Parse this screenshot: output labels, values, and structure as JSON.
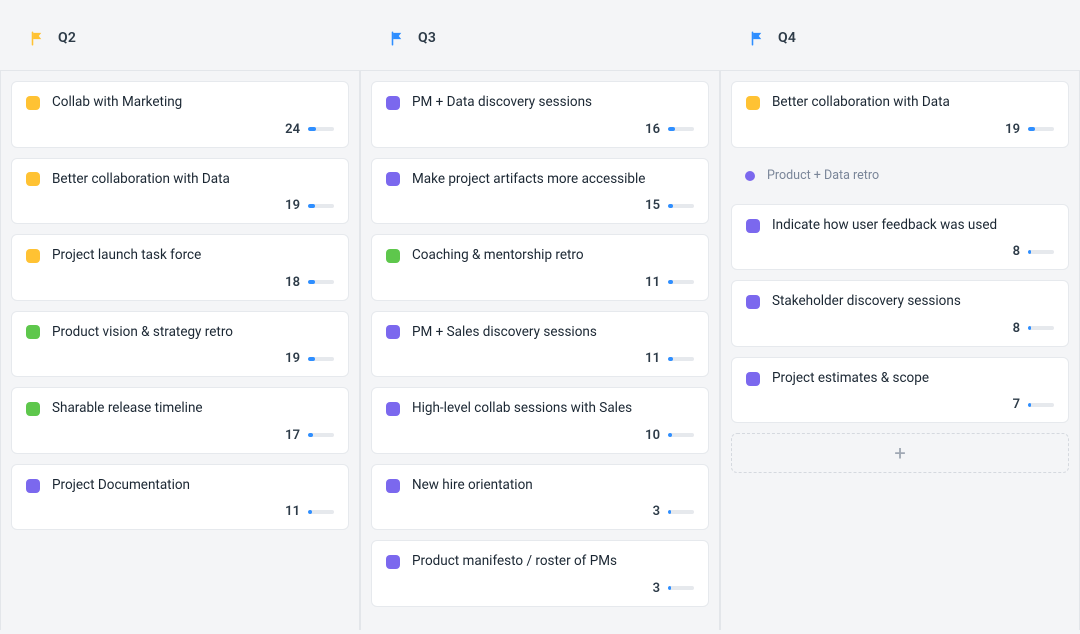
{
  "flagColors": {
    "yellow": "#ffc233",
    "blue": "#2e8eff",
    "green": "#5ec74c",
    "purple": "#7b68ee"
  },
  "columns": [
    {
      "id": "q2",
      "title": "Q2",
      "flagColor": "yellow",
      "cards": [
        {
          "title": "Collab with Marketing",
          "color": "yellow",
          "count": 24,
          "progressPct": 30
        },
        {
          "title": "Better collaboration with Data",
          "color": "yellow",
          "count": 19,
          "progressPct": 25
        },
        {
          "title": "Project launch task force",
          "color": "yellow",
          "count": 18,
          "progressPct": 25
        },
        {
          "title": "Product vision & strategy retro",
          "color": "green",
          "count": 19,
          "progressPct": 25
        },
        {
          "title": "Sharable release timeline",
          "color": "green",
          "count": 17,
          "progressPct": 20
        },
        {
          "title": "Project Documentation",
          "color": "purple",
          "count": 11,
          "progressPct": 15
        }
      ]
    },
    {
      "id": "q3",
      "title": "Q3",
      "flagColor": "blue",
      "cards": [
        {
          "title": "PM + Data discovery sessions",
          "color": "purple",
          "count": 16,
          "progressPct": 25
        },
        {
          "title": "Make project artifacts more accessible",
          "color": "purple",
          "count": 15,
          "progressPct": 20
        },
        {
          "title": "Coaching & mentorship retro",
          "color": "green",
          "count": 11,
          "progressPct": 18
        },
        {
          "title": "PM + Sales discovery sessions",
          "color": "purple",
          "count": 11,
          "progressPct": 18
        },
        {
          "title": "High-level collab sessions with Sales",
          "color": "purple",
          "count": 10,
          "progressPct": 15
        },
        {
          "title": "New hire orientation",
          "color": "purple",
          "count": 3,
          "progressPct": 10
        },
        {
          "title": "Product manifesto / roster of PMs",
          "color": "purple",
          "count": 3,
          "progressPct": 10
        }
      ]
    },
    {
      "id": "q4",
      "title": "Q4",
      "flagColor": "blue",
      "cards": [
        {
          "title": "Better collaboration with Data",
          "color": "yellow",
          "count": 19,
          "progressPct": 25
        },
        {
          "title": "Product + Data retro",
          "color": "purple",
          "compact": true
        },
        {
          "title": "Indicate how user feedback was used",
          "color": "purple",
          "count": 8,
          "progressPct": 12
        },
        {
          "title": "Stakeholder discovery sessions",
          "color": "purple",
          "count": 8,
          "progressPct": 12
        },
        {
          "title": "Project estimates & scope",
          "color": "purple",
          "count": 7,
          "progressPct": 10
        }
      ],
      "hasAddCard": true
    }
  ]
}
